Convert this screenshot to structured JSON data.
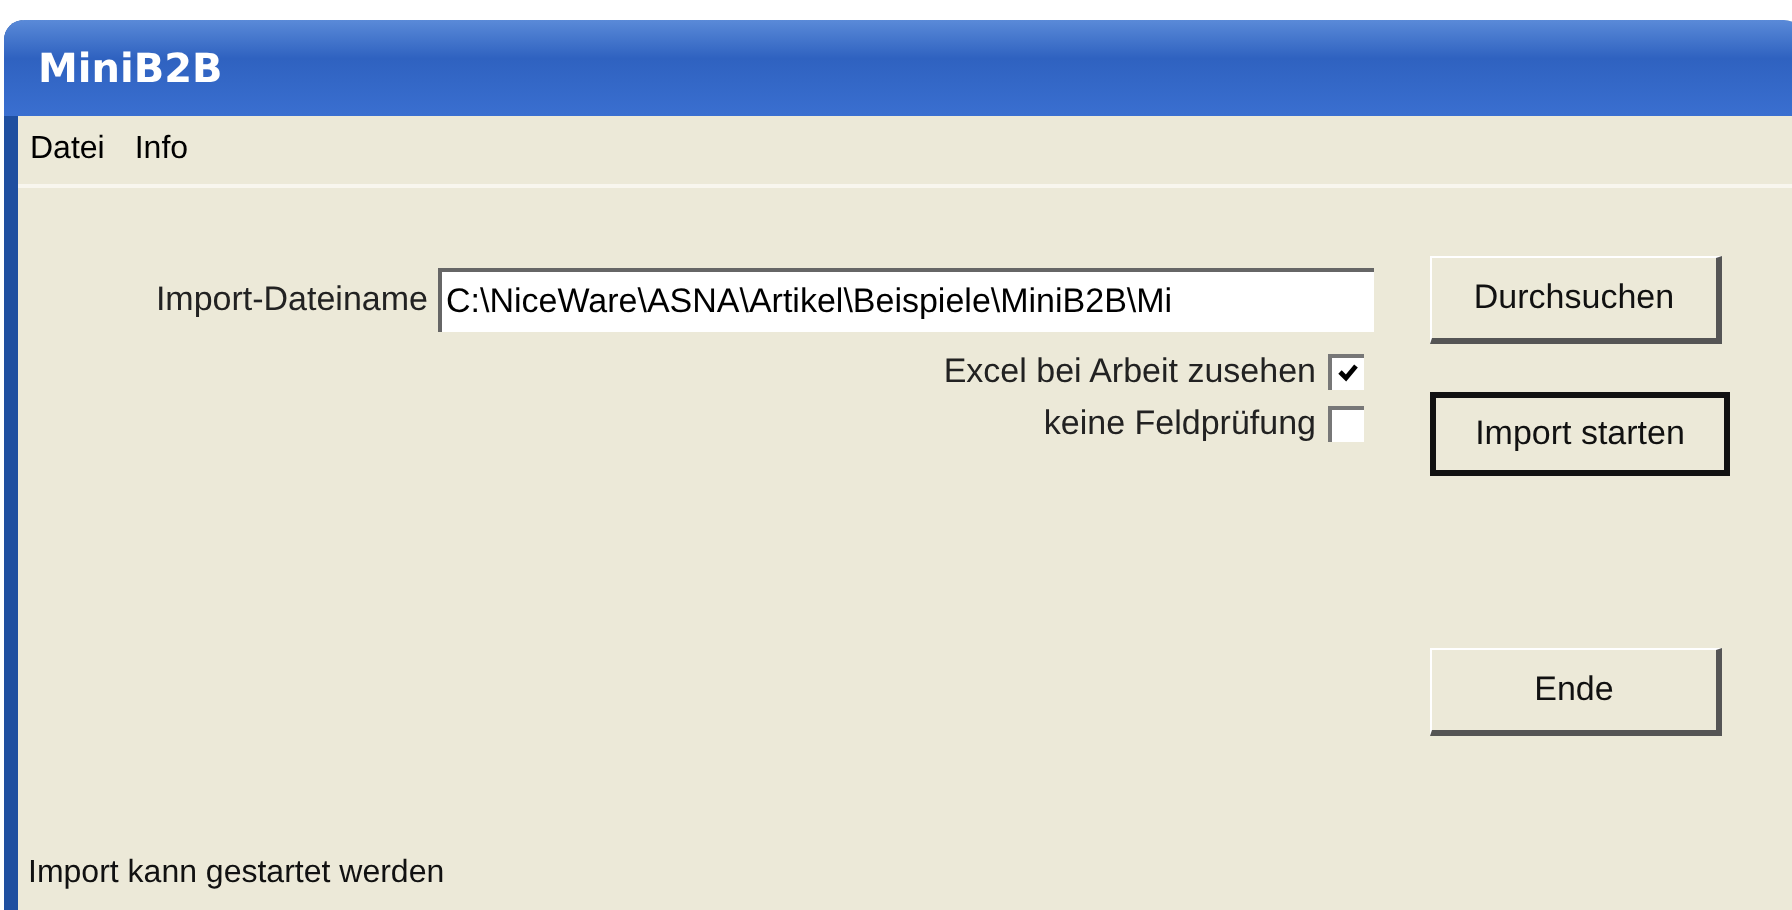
{
  "window": {
    "title": "MiniB2B"
  },
  "menu": [
    "Datei",
    "Info"
  ],
  "import_field": {
    "label": "Import-Dateiname",
    "value": "C:\\NiceWare\\ASNA\\Artikel\\Beispiele\\MiniB2B\\Mi"
  },
  "options": [
    {
      "label": "Excel bei Arbeit zusehen",
      "checked": true
    },
    {
      "label": "keine Feldprüfung",
      "checked": false
    }
  ],
  "buttons": [
    {
      "label": "Durchsuchen",
      "default": false
    },
    {
      "label": "Import starten",
      "default": true
    },
    {
      "label": "Ende",
      "default": false
    }
  ],
  "status_bar": "Import kann gestartet werden"
}
